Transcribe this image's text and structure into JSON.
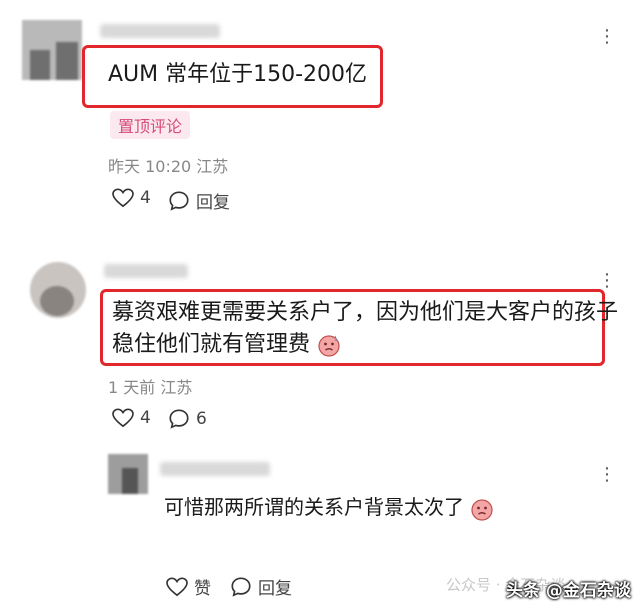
{
  "comments": [
    {
      "text": "AUM 常年位于150-200亿",
      "pinned_label": "置顶评论",
      "meta": "昨天 10:20 江苏",
      "likes": "4",
      "reply_label": "回复",
      "more_icon": "more-dots-icon"
    },
    {
      "text_line1": "募资艰难更需要关系户了，因为他们是大客户的孩子",
      "text_line2": "稳住他们就有管理费",
      "meta": "1 天前 江苏",
      "likes": "4",
      "replies": "6",
      "more_icon": "more-dots-icon"
    },
    {
      "text": "可惜那两所谓的关系户背景太次了",
      "like_label": "赞",
      "reply_label": "回复",
      "more_icon": "more-dots-icon"
    }
  ],
  "watermark": {
    "text": "头条 @金石杂谈",
    "faded": "公众号 · 金石杂谈"
  },
  "colors": {
    "highlight": "#e1262c",
    "pin_text": "#d84c78",
    "pin_bg": "#fbe9ef"
  }
}
